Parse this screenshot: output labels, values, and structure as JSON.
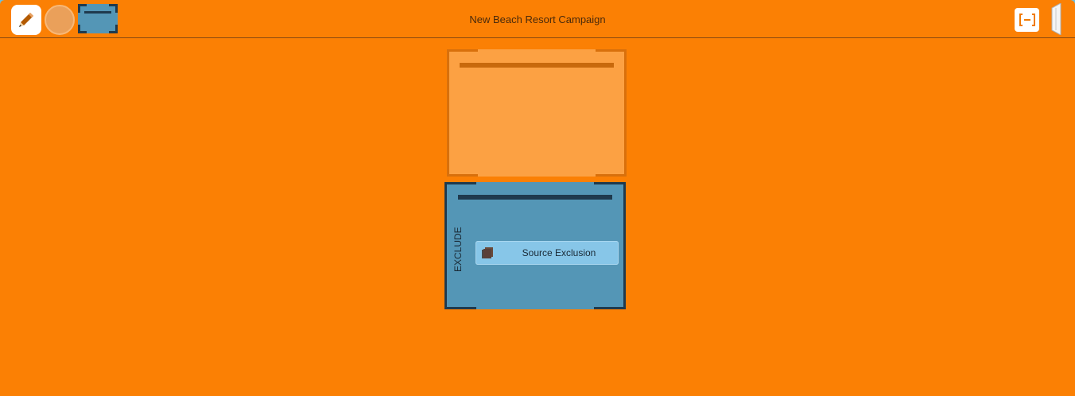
{
  "header": {
    "title": "New Beach Resort Campaign"
  },
  "toolbar": {
    "tools": [
      {
        "name": "pencil-icon",
        "label": "Edit"
      },
      {
        "name": "circle-set-icon",
        "label": "Add set"
      },
      {
        "name": "box-set-icon",
        "label": "Add exclude set"
      }
    ],
    "fit_icon": "fit-to-screen-icon",
    "collapse_icon": "collapse-panel-icon"
  },
  "canvas": {
    "include_set": {
      "color": "#fca143",
      "border_color": "#d8700c",
      "items": []
    },
    "exclude_set": {
      "label": "EXCLUDE",
      "color": "#5496b6",
      "border_color": "#1f3a4e",
      "items": [
        {
          "label": "Source Exclusion",
          "icon": "source-stack-icon"
        }
      ]
    }
  },
  "colors": {
    "background": "#fb8004",
    "chip": "#87c6e8"
  }
}
